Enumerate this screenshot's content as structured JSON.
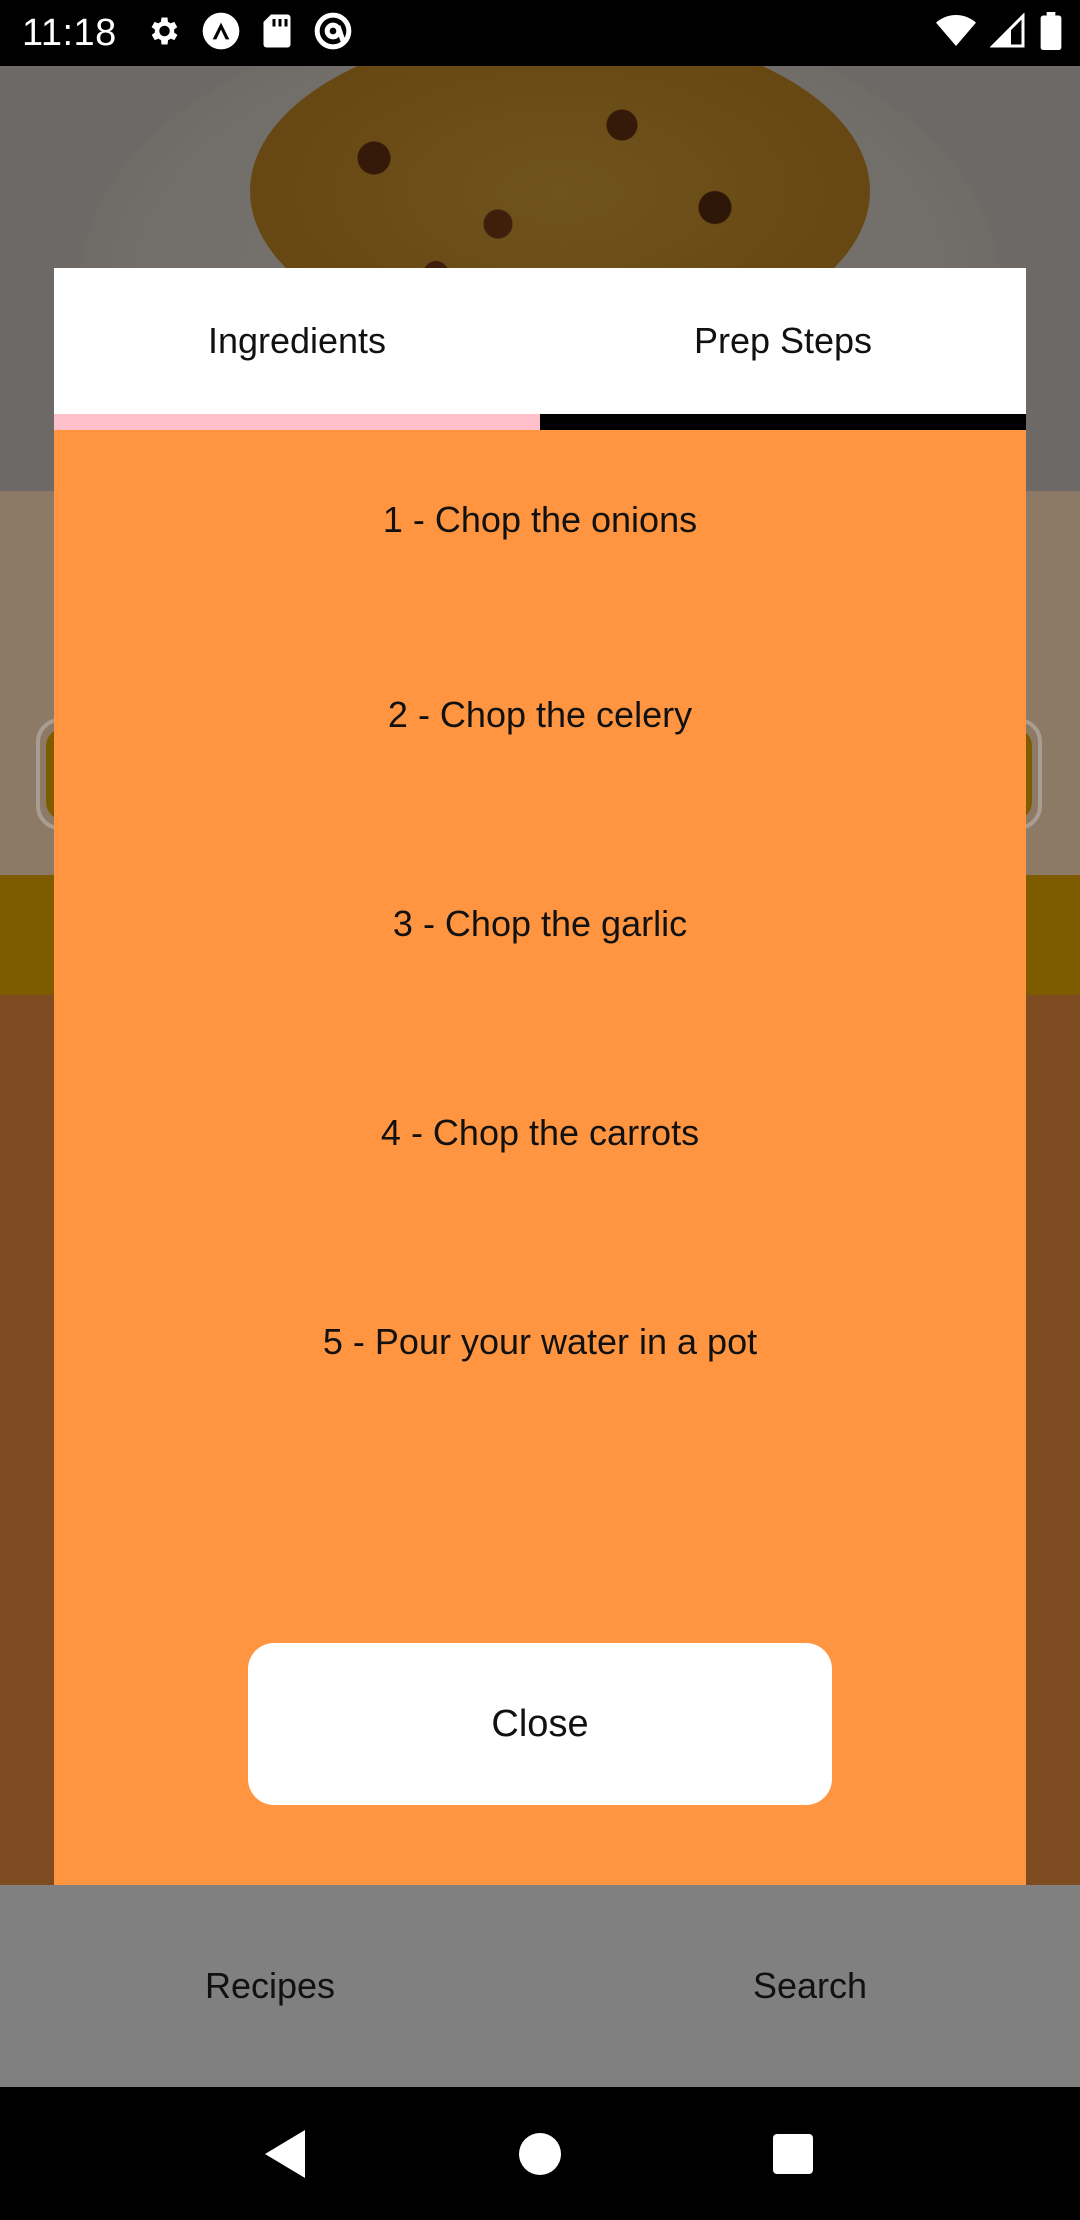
{
  "status_bar": {
    "time": "11:18",
    "left_icons": [
      "settings-icon",
      "a-logo-icon",
      "sd-card-icon",
      "at-sign-icon"
    ],
    "right_icons": [
      "wifi-icon",
      "cell-signal-icon",
      "battery-icon"
    ]
  },
  "bottom_nav": {
    "items": [
      {
        "label": "Recipes"
      },
      {
        "label": "Search"
      }
    ]
  },
  "modal": {
    "tabs": [
      {
        "label": "Ingredients"
      },
      {
        "label": "Prep Steps"
      }
    ],
    "steps": [
      "1 - Chop the onions",
      "2 - Chop the celery",
      "3 - Chop the garlic",
      "4 - Chop the carrots",
      "5 - Pour your water in a pot"
    ],
    "close_label": "Close"
  },
  "colors": {
    "modal_bg": "#ff9540",
    "active_tab_indicator": "#ffc0cb",
    "inactive_tab_indicator": "#000000",
    "bottom_nav_bg": "#808080"
  },
  "android_nav": [
    "back-icon",
    "home-icon",
    "recents-icon"
  ]
}
